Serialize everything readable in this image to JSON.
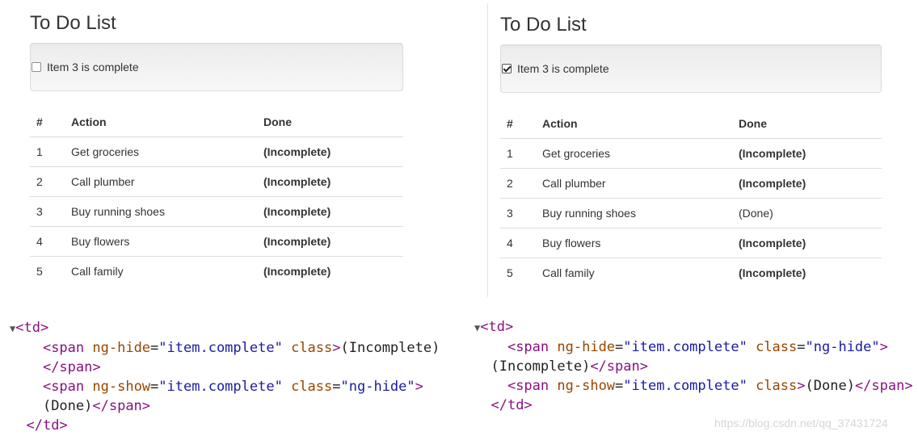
{
  "left_panel": {
    "title": "To Do List",
    "checkbox_label": "Item 3 is complete",
    "checkbox_checked": false,
    "columns": [
      "#",
      "Action",
      "Done"
    ],
    "rows": [
      {
        "num": "1",
        "action": "Get groceries",
        "status": "(Incomplete)"
      },
      {
        "num": "2",
        "action": "Call plumber",
        "status": "(Incomplete)"
      },
      {
        "num": "3",
        "action": "Buy running shoes",
        "status": "(Incomplete)"
      },
      {
        "num": "4",
        "action": "Buy flowers",
        "status": "(Incomplete)"
      },
      {
        "num": "5",
        "action": "Call family",
        "status": "(Incomplete)"
      }
    ]
  },
  "right_panel": {
    "title": "To Do List",
    "checkbox_label": "Item 3 is complete",
    "checkbox_checked": true,
    "columns": [
      "#",
      "Action",
      "Done"
    ],
    "rows": [
      {
        "num": "1",
        "action": "Get groceries",
        "status": "(Incomplete)"
      },
      {
        "num": "2",
        "action": "Call plumber",
        "status": "(Incomplete)"
      },
      {
        "num": "3",
        "action": "Buy running shoes",
        "status": "(Done)"
      },
      {
        "num": "4",
        "action": "Buy flowers",
        "status": "(Incomplete)"
      },
      {
        "num": "5",
        "action": "Call family",
        "status": "(Incomplete)"
      }
    ]
  },
  "left_code": {
    "td_open": "<td>",
    "span1_open": "<span",
    "span1_attr1": "ng-hide",
    "span1_val1": "\"item.complete\"",
    "span1_attr2": "class",
    "span1_text": "(Incomplete)",
    "span1_close": "</span>",
    "span2_open": "<span",
    "span2_attr1": "ng-show",
    "span2_val1": "\"item.complete\"",
    "span2_attr2": "class",
    "span2_val2": "\"ng-hide\"",
    "span2_text": "(Done)",
    "span2_close": "</span>",
    "td_close": "</td>"
  },
  "right_code": {
    "td_open": "<td>",
    "span1_open": "<span",
    "span1_attr1": "ng-hide",
    "span1_val1": "\"item.complete\"",
    "span1_attr2": "class",
    "span1_val2": "\"ng-hide\"",
    "span1_text": "(Incomplete)",
    "span1_close": "</span>",
    "span2_open": "<span",
    "span2_attr1": "ng-show",
    "span2_val1": "\"item.complete\"",
    "span2_attr2": "class",
    "span2_text": "(Done)",
    "span2_close": "</span>",
    "td_close": "</td>"
  },
  "watermark": "https://blog.csdn.net/qq_37431724",
  "colors": {
    "tag": "#881280",
    "attr": "#994500",
    "value": "#1a1aa6",
    "border": "#dddddd",
    "well_bg": "#f5f5f5"
  }
}
